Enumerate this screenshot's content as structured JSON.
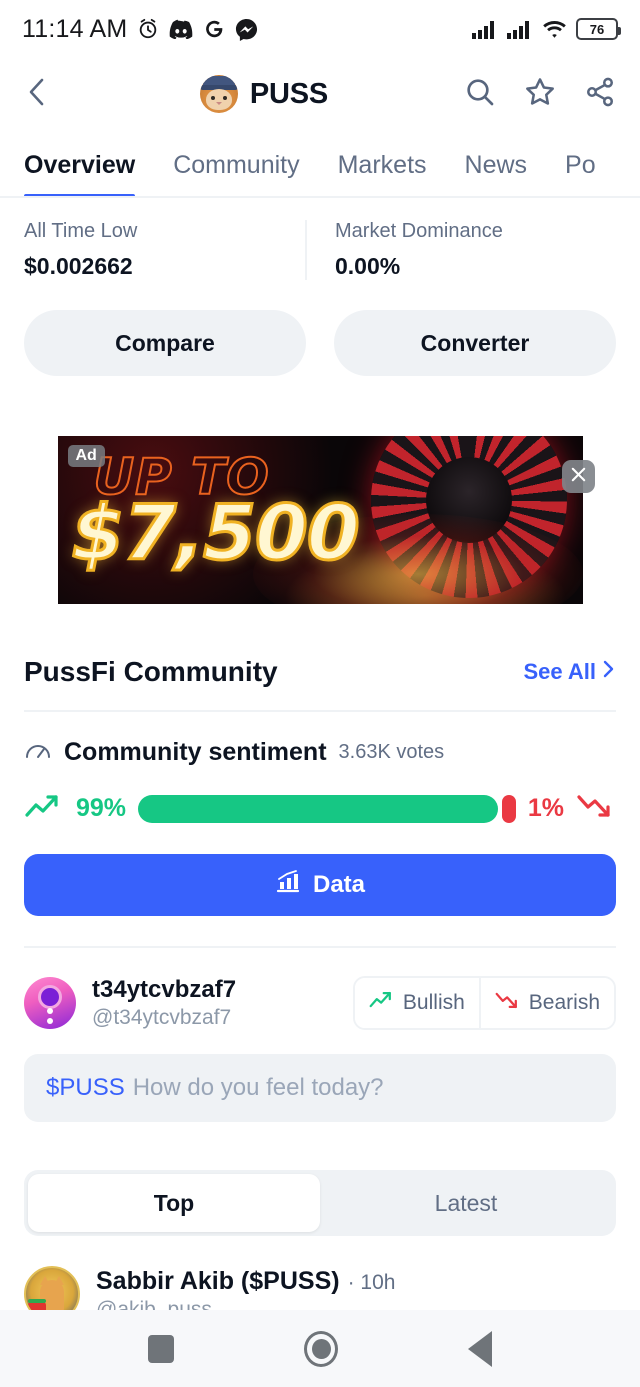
{
  "status_bar": {
    "time": "11:14 AM",
    "icons": [
      "alarm-icon",
      "discord-icon",
      "google-icon",
      "messenger-icon"
    ],
    "signal_bars": 2,
    "wifi": "wifi-icon",
    "battery_level": "76"
  },
  "header": {
    "back_icon": "chevron-left-icon",
    "coin_logo": "puss-cat-logo",
    "title": "PUSS",
    "actions": [
      "search-icon",
      "star-icon",
      "share-icon"
    ]
  },
  "tabs": [
    {
      "label": "Overview",
      "active": true
    },
    {
      "label": "Community",
      "active": false
    },
    {
      "label": "Markets",
      "active": false
    },
    {
      "label": "News",
      "active": false
    },
    {
      "label": "Po",
      "active": false
    }
  ],
  "stats": [
    {
      "label": "All Time Low",
      "value": "$0.002662"
    },
    {
      "label": "Market Dominance",
      "value": "0.00%"
    }
  ],
  "actions": {
    "compare_label": "Compare",
    "converter_label": "Converter"
  },
  "ad": {
    "badge": "Ad",
    "line1": "UP TO",
    "line2": "$7,500",
    "close_icon": "close-icon"
  },
  "community": {
    "section_title": "PussFi Community",
    "see_all_label": "See All",
    "see_all_icon": "chevron-right-icon",
    "sentiment": {
      "icon": "gauge-icon",
      "title": "Community sentiment",
      "votes": "3.63K votes",
      "bullish_pct": "99%",
      "bearish_pct": "1%",
      "bullish_value": 99,
      "bearish_value": 1,
      "bullish_icon": "trend-up-icon",
      "bearish_icon": "trend-down-icon",
      "bullish_color": "#16c784",
      "bearish_color": "#ea3943"
    },
    "data_button": {
      "label": "Data",
      "icon": "bar-chart-icon",
      "color": "#3861fb"
    },
    "user": {
      "avatar": "user-avatar",
      "name": "t34ytcvbzaf7",
      "handle": "@t34ytcvbzaf7",
      "bullish_label": "Bullish",
      "bearish_label": "Bearish"
    },
    "post_box": {
      "ticker": "$PUSS",
      "placeholder": "How do you feel today?"
    },
    "feed_tabs": [
      {
        "label": "Top",
        "active": true
      },
      {
        "label": "Latest",
        "active": false
      }
    ],
    "posts": [
      {
        "avatar": "sabbir-akib-avatar",
        "author": "Sabbir Akib ($PUSS)",
        "time": "· 10h",
        "handle": "@akib_puss"
      }
    ]
  },
  "nav_bar": {
    "recents_icon": "square-recents-icon",
    "home_icon": "circle-home-icon",
    "back_icon": "triangle-back-icon"
  }
}
